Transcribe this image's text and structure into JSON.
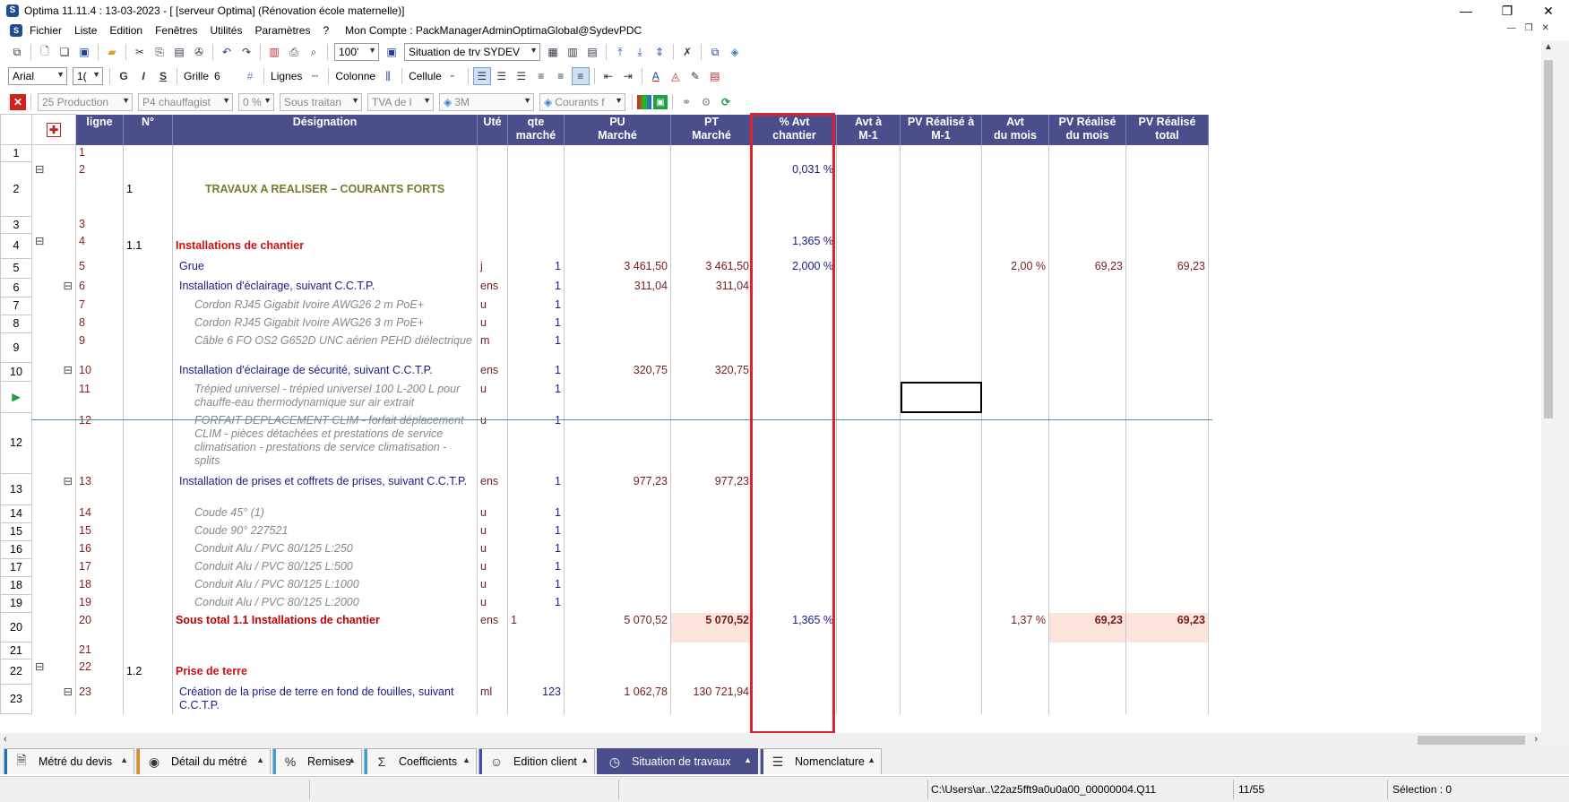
{
  "window": {
    "title": "Optima 11.11.4 : 13-03-2023 - [ [serveur Optima] (Rénovation école maternelle)]",
    "minimize": "—",
    "restore": "❐",
    "close": "✕"
  },
  "menu": {
    "items": [
      "Fichier",
      "Liste",
      "Edition",
      "Fenêtres",
      "Utilités",
      "Paramètres",
      "?"
    ],
    "account": "Mon Compte : PackManagerAdminOptimaGlobal@SydevPDC"
  },
  "toolbar1": {
    "zoom": "100'",
    "view_select": "Situation de trv  SYDEV"
  },
  "toolbar2": {
    "font": "Arial",
    "font_size": "1(",
    "bold": "G",
    "italic": "I",
    "strike": "S",
    "grille_label": "Grille",
    "grille_value": "6",
    "lignes_label": "Lignes",
    "colonne_label": "Colonne",
    "cellule_label": "Cellule"
  },
  "toolbar3": {
    "filter1": "25  Production",
    "filter2": "P4  chauffagist",
    "filter3": "0 %",
    "filter4": "Sous traitan",
    "filter5": "TVA de l",
    "filter6": "3M",
    "filter7": "Courants f"
  },
  "grid": {
    "headers": {
      "ligne": "ligne",
      "num": "N°",
      "designation": "Désignation",
      "ute": "Uté",
      "qte1": "qte",
      "qte2": "marché",
      "pu1": "PU",
      "pu2": "Marché",
      "pt1": "PT",
      "pt2": "Marché",
      "avt1": "% Avt",
      "avt2": "chantier",
      "avtm1_1": "Avt à",
      "avtm1_2": "M-1",
      "pvm1_1": "PV Réalisé à",
      "pvm1_2": "M-1",
      "avtmois1": "Avt",
      "avtmois2": "du mois",
      "pvmois1": "PV Réalisé",
      "pvmois2": "du mois",
      "pvtot1": "PV Réalisé",
      "pvtot2": "total"
    },
    "rows": [
      {
        "rn": "1",
        "ex": "",
        "ligne": "1",
        "num": "",
        "des": "",
        "ute": "",
        "qte": "",
        "pu": "",
        "pt": "",
        "avt": "",
        "avtm1": "",
        "pvm1": "",
        "avtmois": "",
        "pvmois": "",
        "pvtot": "",
        "cls": ""
      },
      {
        "rn": "2",
        "ex": "⊟",
        "ligne": "2",
        "num": "1",
        "des": "TRAVAUX A REALISER – COURANTS FORTS",
        "ute": "",
        "qte": "",
        "pu": "",
        "pt": "",
        "avt": "0,031 %",
        "avtm1": "",
        "pvm1": "",
        "avtmois": "",
        "pvmois": "",
        "pvtot": "",
        "cls": "lvl1"
      },
      {
        "rn": "3",
        "ex": "",
        "ligne": "3",
        "num": "",
        "des": "",
        "ute": "",
        "qte": "",
        "pu": "",
        "pt": "",
        "avt": "",
        "avtm1": "",
        "pvm1": "",
        "avtmois": "",
        "pvmois": "",
        "pvtot": "",
        "cls": ""
      },
      {
        "rn": "4",
        "ex": "⊟",
        "ligne": "4",
        "num": "1.1",
        "des": "Installations de chantier",
        "ute": "",
        "qte": "",
        "pu": "",
        "pt": "",
        "avt": "1,365 %",
        "avtm1": "",
        "pvm1": "",
        "avtmois": "",
        "pvmois": "",
        "pvtot": "",
        "cls": "lvl2"
      },
      {
        "rn": "5",
        "ex": "",
        "ligne": "5",
        "num": "",
        "des": "Grue",
        "ute": "j",
        "qte": "1",
        "pu": "3 461,50",
        "pt": "3 461,50",
        "avt": "2,000 %",
        "avtm1": "",
        "pvm1": "",
        "avtmois": "2,00 %",
        "pvmois": "69,23",
        "pvtot": "69,23",
        "cls": "lvl3"
      },
      {
        "rn": "6",
        "ex": "⊟",
        "ligne": "6",
        "num": "",
        "des": "Installation d'éclairage, suivant C.C.T.P.",
        "ute": "ens",
        "qte": "1",
        "pu": "311,04",
        "pt": "311,04",
        "avt": "",
        "avtm1": "",
        "pvm1": "",
        "avtmois": "",
        "pvmois": "",
        "pvtot": "",
        "cls": "lvl3"
      },
      {
        "rn": "7",
        "ex": "",
        "ligne": "7",
        "num": "",
        "des": "Cordon RJ45 Gigabit Ivoire AWG26 2 m PoE+",
        "ute": "u",
        "qte": "1",
        "pu": "",
        "pt": "",
        "avt": "",
        "avtm1": "",
        "pvm1": "",
        "avtmois": "",
        "pvmois": "",
        "pvtot": "",
        "cls": "lvl4"
      },
      {
        "rn": "8",
        "ex": "",
        "ligne": "8",
        "num": "",
        "des": "Cordon RJ45 Gigabit Ivoire AWG26 3 m PoE+",
        "ute": "u",
        "qte": "1",
        "pu": "",
        "pt": "",
        "avt": "",
        "avtm1": "",
        "pvm1": "",
        "avtmois": "",
        "pvmois": "",
        "pvtot": "",
        "cls": "lvl4"
      },
      {
        "rn": "9",
        "ex": "",
        "ligne": "9",
        "num": "",
        "des": "Câble 6 FO OS2 G652D UNC aérien PEHD diélectrique",
        "ute": "m",
        "qte": "1",
        "pu": "",
        "pt": "",
        "avt": "",
        "avtm1": "",
        "pvm1": "",
        "avtmois": "",
        "pvmois": "",
        "pvtot": "",
        "cls": "lvl4"
      },
      {
        "rn": "10",
        "ex": "⊟",
        "ligne": "10",
        "num": "",
        "des": "Installation d'éclairage de sécurité, suivant C.C.T.P.",
        "ute": "ens",
        "qte": "1",
        "pu": "320,75",
        "pt": "320,75",
        "avt": "",
        "avtm1": "",
        "pvm1": "",
        "avtmois": "",
        "pvmois": "",
        "pvtot": "",
        "cls": "lvl3"
      },
      {
        "rn": "▶",
        "ex": "",
        "ligne": "11",
        "num": "",
        "des": "Trépied universel - trépied universel 100 L-200 L pour chauffe-eau thermodynamique sur air extrait",
        "ute": "u",
        "qte": "1",
        "pu": "",
        "pt": "",
        "avt": "",
        "avtm1": "",
        "pvm1": "",
        "avtmois": "",
        "pvmois": "",
        "pvtot": "",
        "cls": "lvl4"
      },
      {
        "rn": "12",
        "ex": "",
        "ligne": "12",
        "num": "",
        "des": "FORFAIT DEPLACEMENT CLIM - forfait déplacement CLIM - pièces détachées et prestations de service climatisation - prestations de service climatisation - splits",
        "ute": "u",
        "qte": "1",
        "pu": "",
        "pt": "",
        "avt": "",
        "avtm1": "",
        "pvm1": "",
        "avtmois": "",
        "pvmois": "",
        "pvtot": "",
        "cls": "lvl4"
      },
      {
        "rn": "13",
        "ex": "⊟",
        "ligne": "13",
        "num": "",
        "des": "Installation de prises et coffrets de prises, suivant C.C.T.P.",
        "ute": "ens",
        "qte": "1",
        "pu": "977,23",
        "pt": "977,23",
        "avt": "",
        "avtm1": "",
        "pvm1": "",
        "avtmois": "",
        "pvmois": "",
        "pvtot": "",
        "cls": "lvl3"
      },
      {
        "rn": "14",
        "ex": "",
        "ligne": "14",
        "num": "",
        "des": "Coude 45° (1)",
        "ute": "u",
        "qte": "1",
        "pu": "",
        "pt": "",
        "avt": "",
        "avtm1": "",
        "pvm1": "",
        "avtmois": "",
        "pvmois": "",
        "pvtot": "",
        "cls": "lvl4"
      },
      {
        "rn": "15",
        "ex": "",
        "ligne": "15",
        "num": "",
        "des": "Coude 90° 227521",
        "ute": "u",
        "qte": "1",
        "pu": "",
        "pt": "",
        "avt": "",
        "avtm1": "",
        "pvm1": "",
        "avtmois": "",
        "pvmois": "",
        "pvtot": "",
        "cls": "lvl4"
      },
      {
        "rn": "16",
        "ex": "",
        "ligne": "16",
        "num": "",
        "des": "Conduit Alu / PVC 80/125 L:250",
        "ute": "u",
        "qte": "1",
        "pu": "",
        "pt": "",
        "avt": "",
        "avtm1": "",
        "pvm1": "",
        "avtmois": "",
        "pvmois": "",
        "pvtot": "",
        "cls": "lvl4"
      },
      {
        "rn": "17",
        "ex": "",
        "ligne": "17",
        "num": "",
        "des": "Conduit Alu / PVC 80/125 L:500",
        "ute": "u",
        "qte": "1",
        "pu": "",
        "pt": "",
        "avt": "",
        "avtm1": "",
        "pvm1": "",
        "avtmois": "",
        "pvmois": "",
        "pvtot": "",
        "cls": "lvl4"
      },
      {
        "rn": "18",
        "ex": "",
        "ligne": "18",
        "num": "",
        "des": "Conduit Alu / PVC 80/125 L:1000",
        "ute": "u",
        "qte": "1",
        "pu": "",
        "pt": "",
        "avt": "",
        "avtm1": "",
        "pvm1": "",
        "avtmois": "",
        "pvmois": "",
        "pvtot": "",
        "cls": "lvl4"
      },
      {
        "rn": "19",
        "ex": "",
        "ligne": "19",
        "num": "",
        "des": "Conduit Alu / PVC 80/125 L:2000",
        "ute": "u",
        "qte": "1",
        "pu": "",
        "pt": "",
        "avt": "",
        "avtm1": "",
        "pvm1": "",
        "avtmois": "",
        "pvmois": "",
        "pvtot": "",
        "cls": "lvl4"
      },
      {
        "rn": "20",
        "ex": "",
        "ligne": "20",
        "num": "",
        "des": "Sous total 1.1 Installations de chantier",
        "ute": "ens",
        "qte": "1",
        "pu": "5 070,52",
        "pt": "5 070,52",
        "avt": "1,365 %",
        "avtm1": "",
        "pvm1": "",
        "avtmois": "1,37 %",
        "pvmois": "69,23",
        "pvtot": "69,23",
        "cls": "subtotal"
      },
      {
        "rn": "21",
        "ex": "",
        "ligne": "21",
        "num": "",
        "des": "",
        "ute": "",
        "qte": "",
        "pu": "",
        "pt": "",
        "avt": "",
        "avtm1": "",
        "pvm1": "",
        "avtmois": "",
        "pvmois": "",
        "pvtot": "",
        "cls": ""
      },
      {
        "rn": "22",
        "ex": "⊟",
        "ligne": "22",
        "num": "1.2",
        "des": "Prise de terre",
        "ute": "",
        "qte": "",
        "pu": "",
        "pt": "",
        "avt": "",
        "avtm1": "",
        "pvm1": "",
        "avtmois": "",
        "pvmois": "",
        "pvtot": "",
        "cls": "lvl2"
      },
      {
        "rn": "23",
        "ex": "⊟",
        "ligne": "23",
        "num": "",
        "des": "Création de la prise de terre en fond de fouilles, suivant C.C.T.P.",
        "ute": "ml",
        "qte": "123",
        "pu": "1 062,78",
        "pt": "130 721,94",
        "avt": "",
        "avtm1": "",
        "pvm1": "",
        "avtmois": "",
        "pvmois": "",
        "pvtot": "",
        "cls": "lvl3"
      }
    ]
  },
  "tabs": [
    {
      "label": "Métré du devis",
      "icon": "document-icon",
      "glyph": "🗎",
      "bar": "#1f6fbf",
      "active": false
    },
    {
      "label": "Détail du métré",
      "icon": "eye-icon",
      "glyph": "◉",
      "bar": "#e08a1a",
      "active": false
    },
    {
      "label": "Remises",
      "icon": "percent-icon",
      "glyph": "%",
      "bar": "#3aa0d8",
      "active": false
    },
    {
      "label": "Coefficients",
      "icon": "sigma-icon",
      "glyph": "Σ",
      "bar": "#3aa0d8",
      "active": false
    },
    {
      "label": "Edition client",
      "icon": "user-icon",
      "glyph": "☺",
      "bar": "#3a4fb0",
      "active": false
    },
    {
      "label": "Situation de travaux",
      "icon": "clock-icon",
      "glyph": "◷",
      "bar": "#4a4f8c",
      "active": true
    },
    {
      "label": "Nomenclature",
      "icon": "list-icon",
      "glyph": "☰",
      "bar": "#4a4f8c",
      "active": false
    }
  ],
  "status": {
    "path": "C:\\Users\\ar..\\22az5fft9a0u0a00_00000004.Q11",
    "position": "11/55",
    "selection": "Sélection : 0"
  },
  "colors": {
    "header_bg": "#4a4f8c",
    "highlight_box": "#e0202a",
    "subtotal_fill": "#fbe4dc"
  }
}
